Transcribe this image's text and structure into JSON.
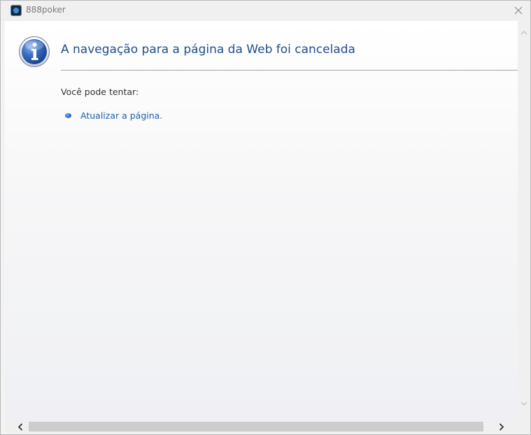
{
  "window": {
    "title": "888poker"
  },
  "page": {
    "heading": "A navegação para a página da Web foi cancelada",
    "try_label": "Você pode tentar:",
    "refresh_link": "Atualizar a página."
  },
  "icons": {
    "app": "888poker-app-icon",
    "close": "close-icon",
    "info": "info-icon",
    "scroll_up": "chevron-up-icon",
    "scroll_down": "chevron-down-icon",
    "scroll_left": "chevron-left-icon",
    "scroll_right": "chevron-right-icon"
  },
  "colors": {
    "heading": "#1f4e8c",
    "link": "#1f5fa8",
    "info_icon": "#2d5fb4"
  }
}
